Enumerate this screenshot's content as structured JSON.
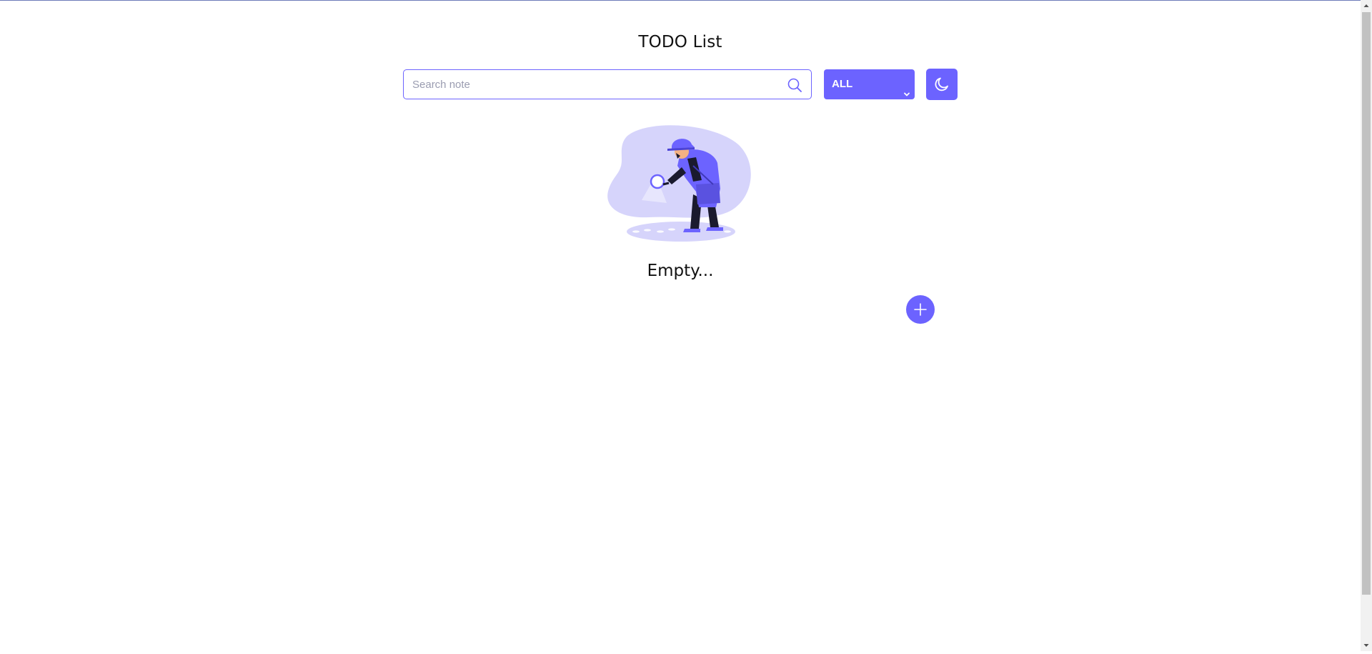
{
  "app": {
    "title": "TODO List"
  },
  "search": {
    "placeholder": "Search note",
    "value": ""
  },
  "filter": {
    "selected": "ALL"
  },
  "theme_toggle": {
    "icon": "moon-icon"
  },
  "empty_state": {
    "illustration": "detective-search-illustration",
    "message": "Empty..."
  },
  "add_button": {
    "icon": "plus-icon"
  },
  "colors": {
    "accent": "#6c63ff",
    "illustration_bg": "#d6d4fb",
    "text": "#111111"
  }
}
